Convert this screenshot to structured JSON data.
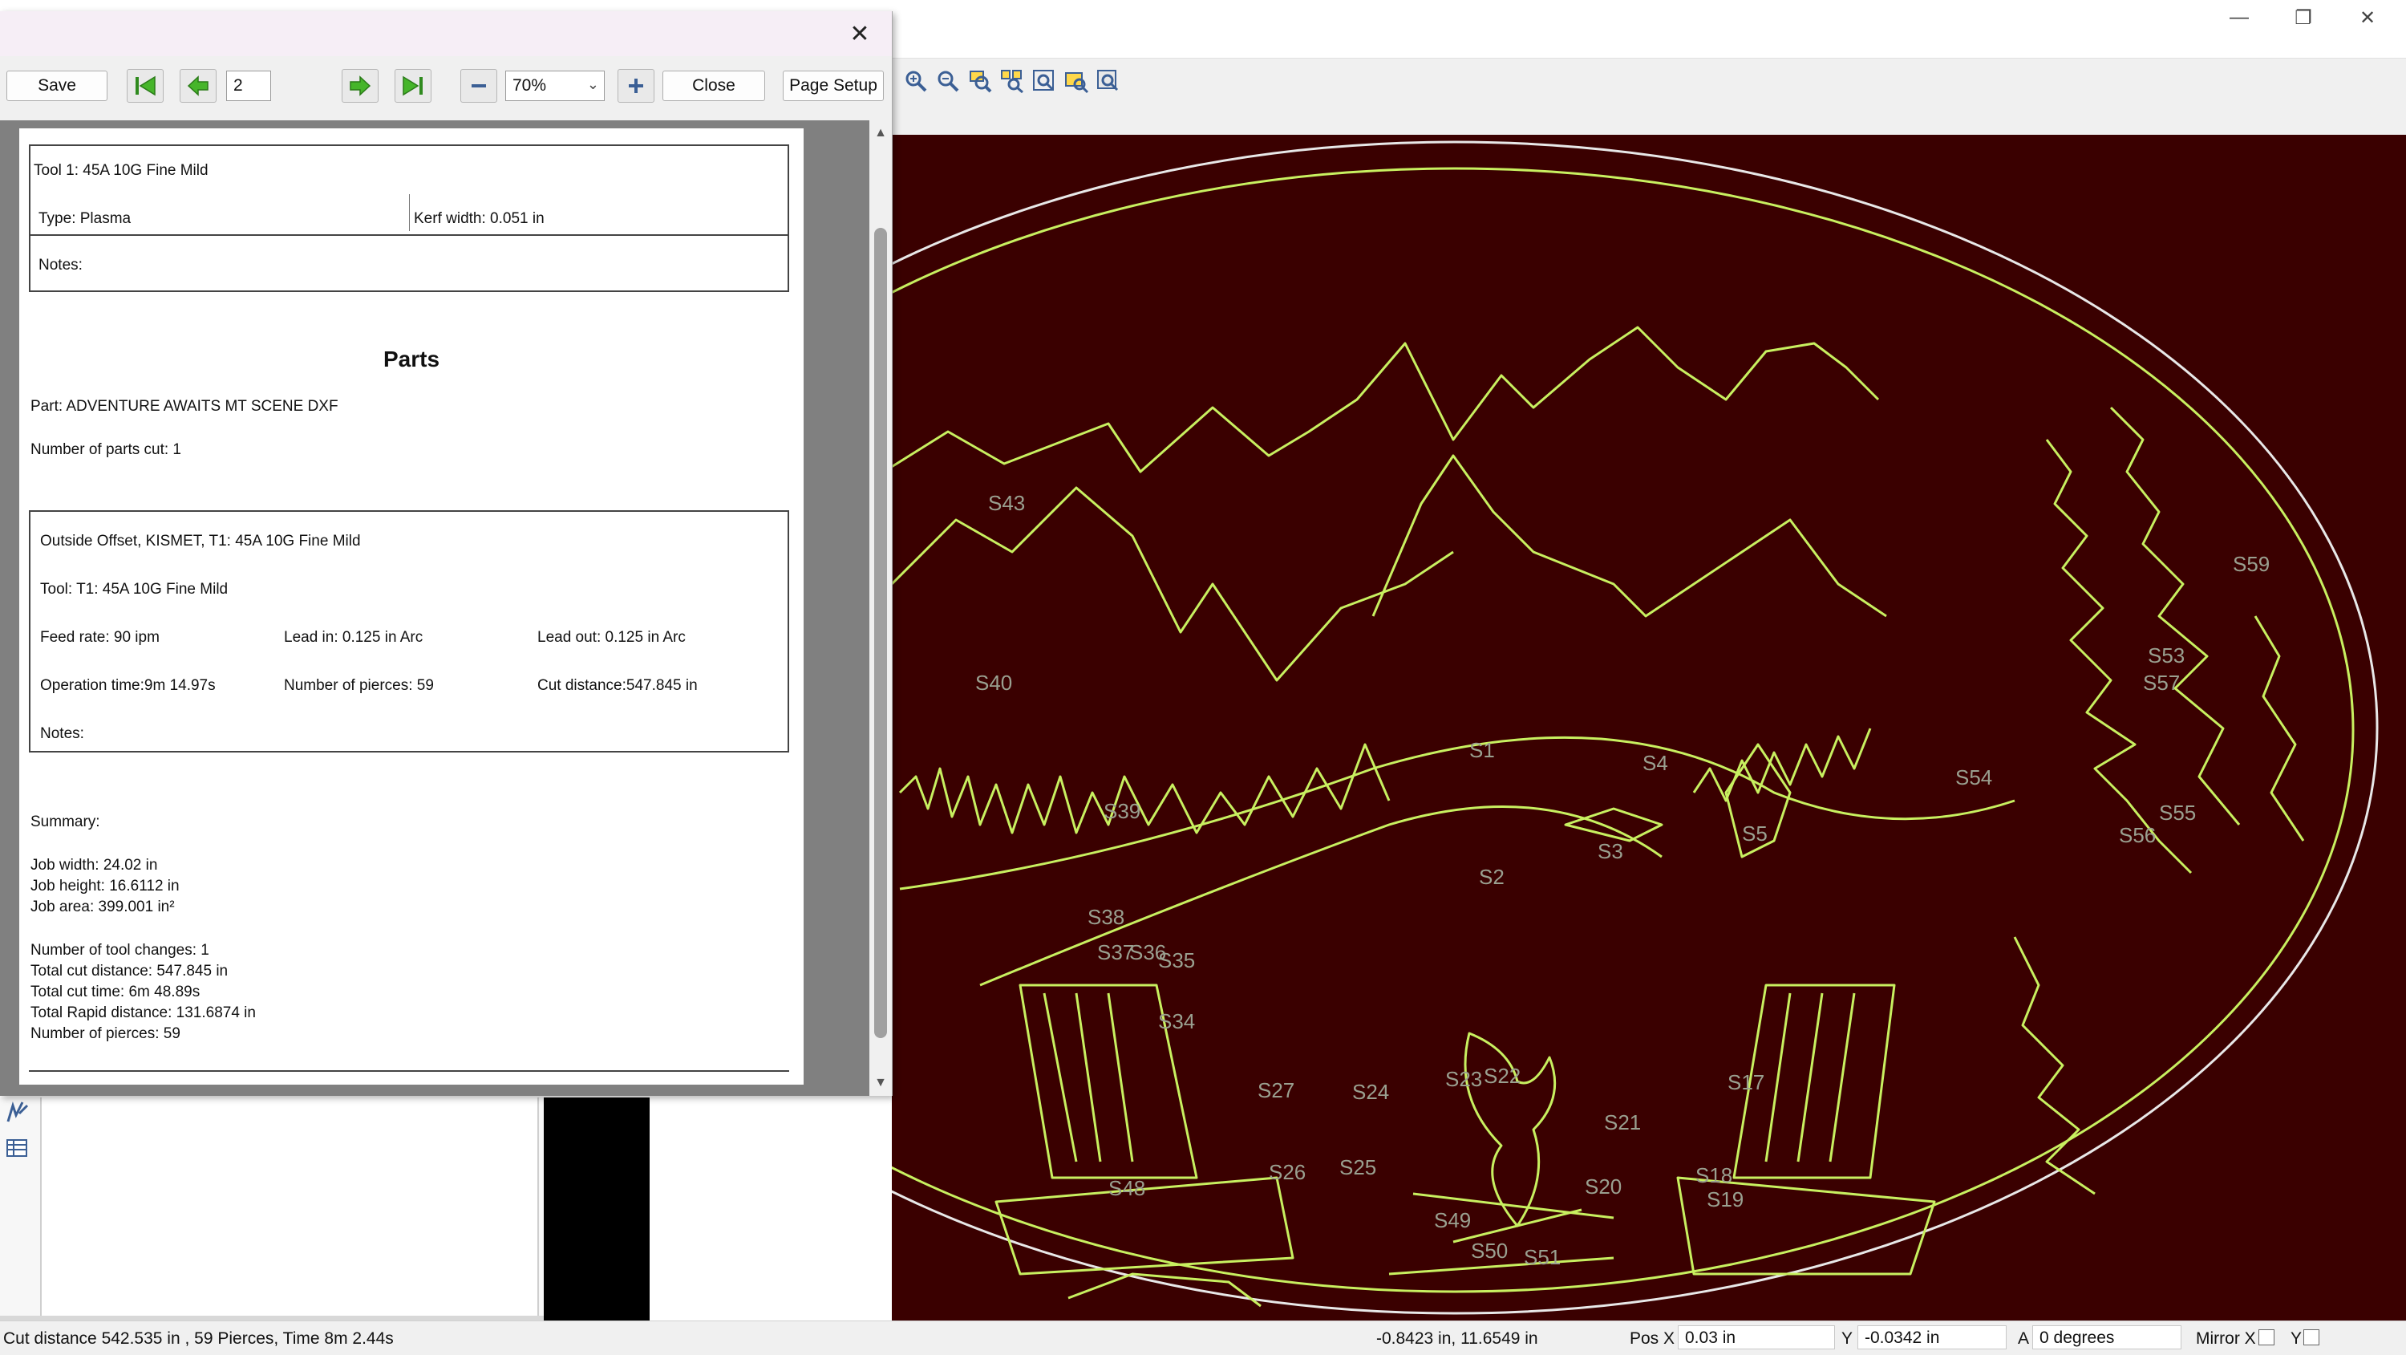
{
  "main_window": {
    "controls": {
      "minimize": "—",
      "maximize": "❐",
      "close": "✕"
    }
  },
  "dialog": {
    "close_glyph": "✕",
    "toolbar": {
      "save_label": "Save",
      "page_number": "2",
      "zoom_value": "70%",
      "close_label": "Close",
      "page_setup_label": "Page Setup"
    }
  },
  "report": {
    "tool": {
      "title": "Tool 1: 45A 10G Fine Mild",
      "type": "Type: Plasma",
      "kerf": "Kerf width: 0.051 in",
      "notes": "Notes:"
    },
    "parts_heading": "Parts",
    "part_name": "Part: ADVENTURE AWAITS MT SCENE DXF",
    "parts_cut": "Number of parts cut: 1",
    "operation": {
      "title": "Outside Offset, KISMET, T1: 45A 10G Fine Mild",
      "tool": "Tool: T1: 45A 10G Fine Mild",
      "feed_rate": "Feed rate: 90 ipm",
      "lead_in": "Lead in: 0.125 in Arc",
      "lead_out": "Lead out: 0.125 in Arc",
      "op_time": "Operation time:9m 14.97s",
      "pierces": "Number of pierces: 59",
      "cut_distance": "Cut distance:547.845 in",
      "notes": "Notes:"
    },
    "summary": {
      "heading": "Summary:",
      "job_width": "Job width: 24.02 in",
      "job_height": "Job height: 16.6112 in",
      "job_area": "Job area: 399.001 in²",
      "tool_changes": "Number of tool changes: 1",
      "total_cut": "Total cut distance: 547.845 in",
      "total_time": "Total cut time: 6m 48.89s",
      "total_rapid": "Total Rapid distance: 131.6874 in",
      "pierces": "Number of pierces: 59"
    }
  },
  "canvas_labels": [
    "S59",
    "S53",
    "S57",
    "S55",
    "S56",
    "S54",
    "S4",
    "S1",
    "S3",
    "S2",
    "S5",
    "S40",
    "S43",
    "S39",
    "S38",
    "S37",
    "S36",
    "S35",
    "S34",
    "S27",
    "S24",
    "S25",
    "S26",
    "S23",
    "S22",
    "S21",
    "S20",
    "S18",
    "S19",
    "S17",
    "S49",
    "S50",
    "S51",
    "S48"
  ],
  "status_bar": {
    "left_text": "Cut distance 542.535 in , 59 Pierces, Time 8m 2.44s",
    "coords": "-0.8423 in, 11.6549 in",
    "pos_x_label": "Pos X",
    "pos_x_value": "0.03 in",
    "y_label": "Y",
    "y_value": "-0.0342 in",
    "a_label": "A",
    "a_value": "0 degrees",
    "mirror_label": "Mirror X",
    "mirror_y_label": "Y"
  },
  "colors": {
    "canvas_bg": "#3a0000",
    "cut_path": "#c8f060",
    "cut_path_outline": "#e0e0e0"
  }
}
